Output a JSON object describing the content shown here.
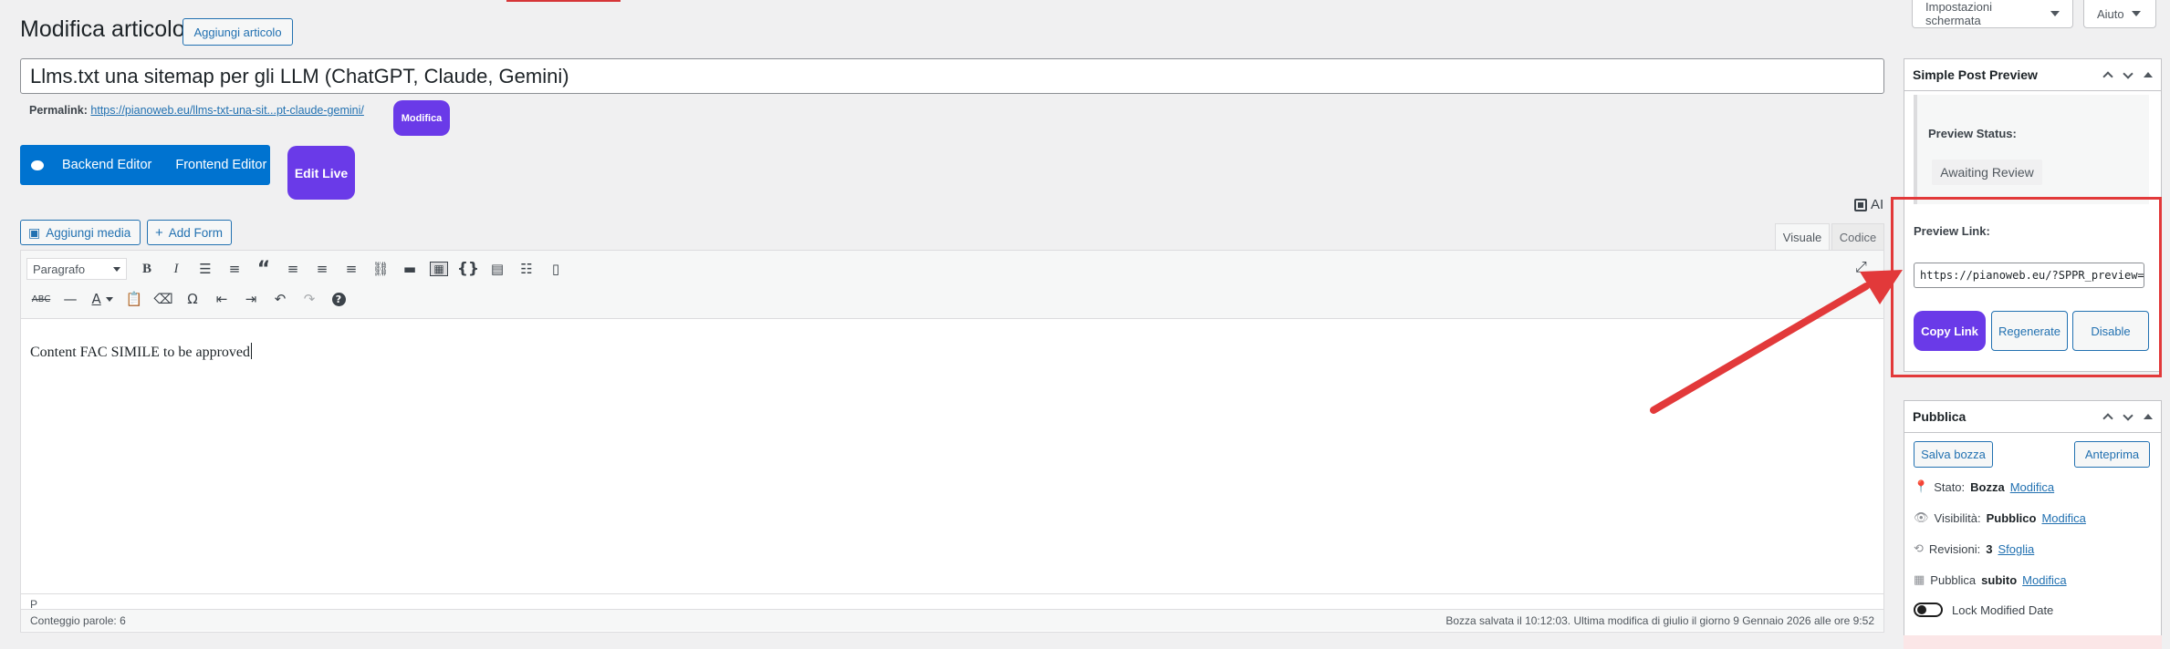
{
  "header": {
    "screen_options": "Impostazioni schermata",
    "help": "Aiuto",
    "page_title": "Modifica articolo",
    "add_new": "Aggiungi articolo"
  },
  "post": {
    "title": "Llms.txt una sitemap per gli LLM (ChatGPT, Claude, Gemini)",
    "permalink_label": "Permalink:",
    "permalink_url": "https://pianoweb.eu/llms-txt-una-sit...pt-claude-gemini/",
    "permalink_edit": "Modifica"
  },
  "builder": {
    "backend_editor": "Backend Editor",
    "frontend_editor": "Frontend Editor",
    "edit_live": "Edit Live",
    "ai": "AI"
  },
  "media": {
    "add_media": "Aggiungi media",
    "add_form": "Add Form"
  },
  "editor": {
    "tab_visual": "Visuale",
    "tab_code": "Codice",
    "format_select": "Paragrafo",
    "content": "Content FAC SIMILE to be approved",
    "path": "P",
    "word_count": "Conteggio parole: 6",
    "save_status": "Bozza salvata il 10:12:03. Ultima modifica di giulio il giorno 9 Gennaio 2026 alle ore 9:52",
    "toolbar_row1": [
      "bold-icon",
      "italic-icon",
      "bullet-list-icon",
      "numbered-list-icon",
      "blockquote-icon",
      "align-left-icon",
      "align-center-icon",
      "align-right-icon",
      "link-icon",
      "read-more-icon",
      "toolbar-toggle-icon",
      "code-braces-icon",
      "document-icon",
      "list-icon",
      "book-icon"
    ],
    "toolbar_row2": [
      "strikethrough-icon",
      "horizontal-line-icon",
      "text-color-icon",
      "paste-text-icon",
      "clear-formatting-icon",
      "special-character-icon",
      "outdent-icon",
      "indent-icon",
      "undo-icon",
      "redo-icon",
      "help-icon"
    ]
  },
  "simple_preview": {
    "title": "Simple Post Preview",
    "status_label": "Preview Status:",
    "status_value": "Awaiting Review",
    "link_label": "Preview Link:",
    "link_value": "https://pianoweb.eu/?SPPR_preview=fc",
    "copy_link": "Copy Link",
    "regenerate": "Regenerate",
    "disable": "Disable"
  },
  "publish": {
    "title": "Pubblica",
    "save_draft": "Salva bozza",
    "preview": "Anteprima",
    "status_label": "Stato:",
    "status_value": "Bozza",
    "visibility_label": "Visibilità:",
    "visibility_value": "Pubblico",
    "revisions_label": "Revisioni:",
    "revisions_value": "3",
    "revisions_link": "Sfoglia",
    "publish_label": "Pubblica",
    "publish_value": "subito",
    "edit": "Modifica",
    "lock_modified": "Lock Modified Date"
  },
  "colors": {
    "accent": "#2271b1",
    "purple": "#6a3ae8",
    "wpbakery_blue": "#0073d0",
    "highlight_red": "#e2393a"
  }
}
